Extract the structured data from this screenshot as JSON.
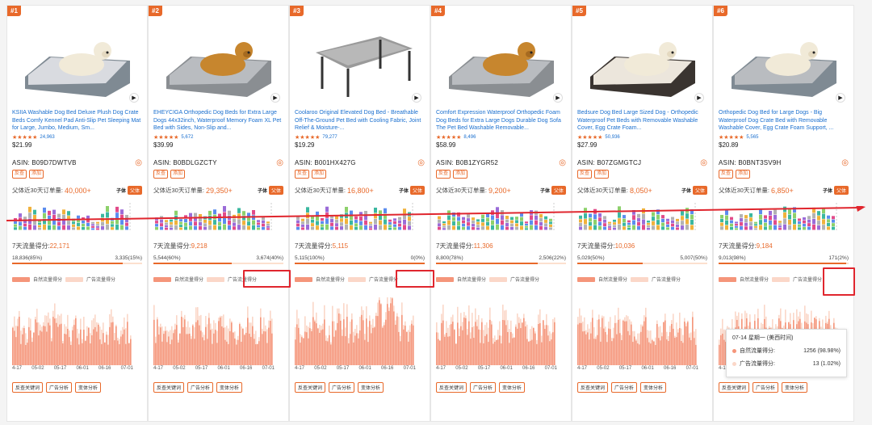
{
  "sales_label": "父体近30天订单量:",
  "sub_label": "子体",
  "parent_button": "父体",
  "score_label": "7天流量得分:",
  "legend": {
    "natural": "自然流量得分",
    "ad": "广告流量得分"
  },
  "actions": [
    "反查关键词",
    "广告分析",
    "变体分析"
  ],
  "x_ticks": [
    "4-17",
    "05-02",
    "05-17",
    "06-01",
    "06-16",
    "07-01"
  ],
  "colors": {
    "accent": "#e8692a",
    "red_box": "#e0262e",
    "natural": "#f5957a",
    "ad": "#fbd7c8",
    "link": "#1a6fcf"
  },
  "tooltip": {
    "date": "07-14 星期一 (美西时间)",
    "natural_label": "自然流量得分:",
    "natural_value": "1256 (98.98%)",
    "ad_label": "广告流量得分:",
    "ad_value": "13 (1.02%)"
  },
  "products": [
    {
      "rank": "#1",
      "title": "KSIIA Washable Dog Bed Deluxe Plush Dog Crate Beds Comfy Kennel Pad Anti-Slip Pet Sleeping Mat for Large, Jumbo, Medium, Sm...",
      "reviews": "24,963",
      "price": "$21.99",
      "asin": "ASIN:  B09D7DWTVB",
      "tags": [
        "反查",
        "添加"
      ],
      "sales": "40,000+",
      "score": "22,171",
      "natural": "18,836(85%)",
      "ad": "3,335(15%)",
      "natural_pct": 85,
      "image": "gray-plush-bed-dog"
    },
    {
      "rank": "#2",
      "title": "EHEYCIGA Orthopedic Dog Beds for Extra Large Dogs 44x32inch, Waterproof Memory Foam XL Pet Bed with Sides, Non-Slip and...",
      "reviews": "5,672",
      "price": "$39.99",
      "asin": "ASIN:  B0BDLGZCTY",
      "tags": [
        "反查",
        "添加"
      ],
      "sales": "29,350+",
      "score": "9,218",
      "natural": "5,544(60%)",
      "ad": "3,674(40%)",
      "natural_pct": 60,
      "image": "bolster-bed-golden"
    },
    {
      "rank": "#3",
      "title": "Coolaroo Original Elevated Dog Bed - Breathable Off-The-Ground Pet Bed with Cooling Fabric, Joint Relief & Moisture-...",
      "reviews": "79,277",
      "price": "$19.29",
      "asin": "ASIN:  B001HX427G",
      "tags": [
        "反查",
        "添加"
      ],
      "sales": "16,800+",
      "score": "5,115",
      "natural": "5,115(100%)",
      "ad": "0(0%)",
      "natural_pct": 100,
      "image": "elevated-cot-bed"
    },
    {
      "rank": "#4",
      "title": "Comfort Expression Waterproof Orthopedic Foam Dog Beds for Extra Large Dogs Durable Dog Sofa The Pet Bed Washable Removable...",
      "reviews": "8,496",
      "price": "$58.99",
      "asin": "ASIN:  B0B1ZYGR52",
      "tags": [
        "反查",
        "添加"
      ],
      "sales": "9,200+",
      "score": "11,306",
      "natural": "8,800(78%)",
      "ad": "2,506(22%)",
      "natural_pct": 78,
      "image": "sofa-bed-golden"
    },
    {
      "rank": "#5",
      "title": "Bedsure Dog Bed Large Sized Dog - Orthopedic Waterproof Pet Beds with Removable Washable Cover, Egg Crate Foam...",
      "reviews": "50,936",
      "price": "$27.99",
      "asin": "ASIN:  B07ZGMGTCJ",
      "tags": [
        "反查",
        "添加"
      ],
      "sales": "8,050+",
      "score": "10,036",
      "natural": "5,029(50%)",
      "ad": "5,007(50%)",
      "natural_pct": 50,
      "image": "flat-foam-bed-lab"
    },
    {
      "rank": "#6",
      "title": "Orthopedic Dog Bed for Large Dogs - Big Waterproof Dog Crate Bed with Removable Washable Cover, Egg Crate Foam Support, ...",
      "reviews": "5,565",
      "price": "$20.89",
      "asin": "ASIN:  B0BNT3SV9H",
      "tags": [
        "反查",
        "添加"
      ],
      "sales": "6,850+",
      "score": "9,184",
      "natural": "9,013(98%)",
      "ad": "171(2%)",
      "natural_pct": 98,
      "image": "gray-foam-bed-lab"
    }
  ]
}
